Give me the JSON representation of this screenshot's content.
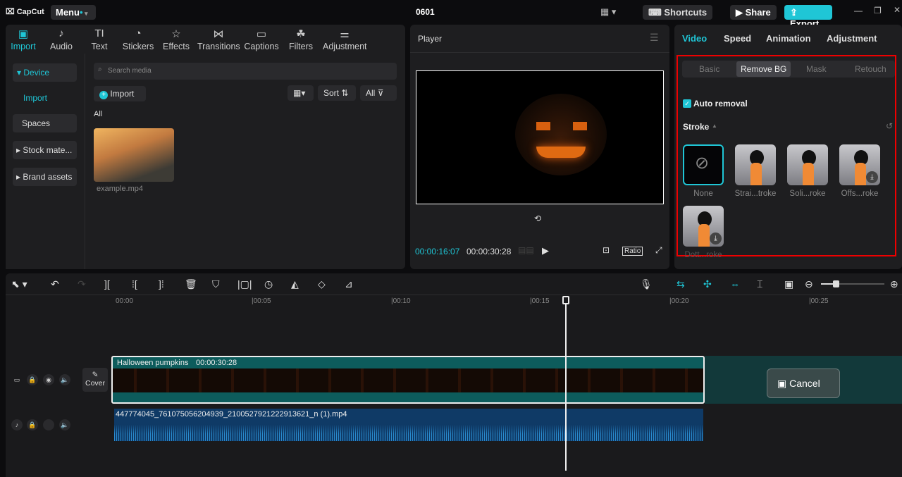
{
  "app": {
    "logo": "CapCut",
    "menu": "Menu",
    "title": "0601",
    "shortcuts": "Shortcuts",
    "share": "Share",
    "export": "Export",
    "accent": "#1fc6d6"
  },
  "media_tabs": [
    {
      "label": "Import",
      "icon": "import-icon"
    },
    {
      "label": "Audio",
      "icon": "audio-icon"
    },
    {
      "label": "Text",
      "icon": "text-icon"
    },
    {
      "label": "Stickers",
      "icon": "stickers-icon"
    },
    {
      "label": "Effects",
      "icon": "effects-icon"
    },
    {
      "label": "Transitions",
      "icon": "transitions-icon"
    },
    {
      "label": "Captions",
      "icon": "captions-icon"
    },
    {
      "label": "Filters",
      "icon": "filters-icon"
    },
    {
      "label": "Adjustment",
      "icon": "adjustment-icon"
    }
  ],
  "sidebar": {
    "device": "▾ Device",
    "import": "Import",
    "spaces": "Spaces",
    "stock": "▸ Stock mate...",
    "brand": "▸ Brand assets"
  },
  "media": {
    "search_placeholder": "Search media",
    "import_button": "Import",
    "sort": "Sort",
    "all_filter": "All",
    "section": "All",
    "file_name": "example.mp4"
  },
  "player": {
    "title": "Player",
    "current_time": "00:00:16:07",
    "total_time": "00:00:30:28",
    "ratio": "Ratio"
  },
  "inspector": {
    "tabs": [
      "Video",
      "Speed",
      "Animation",
      "Adjustment"
    ],
    "subtabs": [
      "Basic",
      "Remove BG",
      "Mask",
      "Retouch"
    ],
    "auto_removal": "Auto removal",
    "auto_removal_checked": true,
    "stroke_label": "Stroke",
    "stroke_options": [
      "None",
      "Strai...troke",
      "Soli...roke",
      "Offs...roke",
      "Dott...roke"
    ]
  },
  "timeline": {
    "ticks": [
      "00:00",
      "|00:05",
      "|00:10",
      "|00:15",
      "|00:20",
      "|00:25"
    ],
    "video_clip_name": "Halloween pumpkins",
    "video_clip_duration": "00:00:30:28",
    "cover": "Cover",
    "audio_clip_name": "447774045_761075056204939_2100527921222913621_n (1).mp4",
    "cancel": "Cancel"
  }
}
